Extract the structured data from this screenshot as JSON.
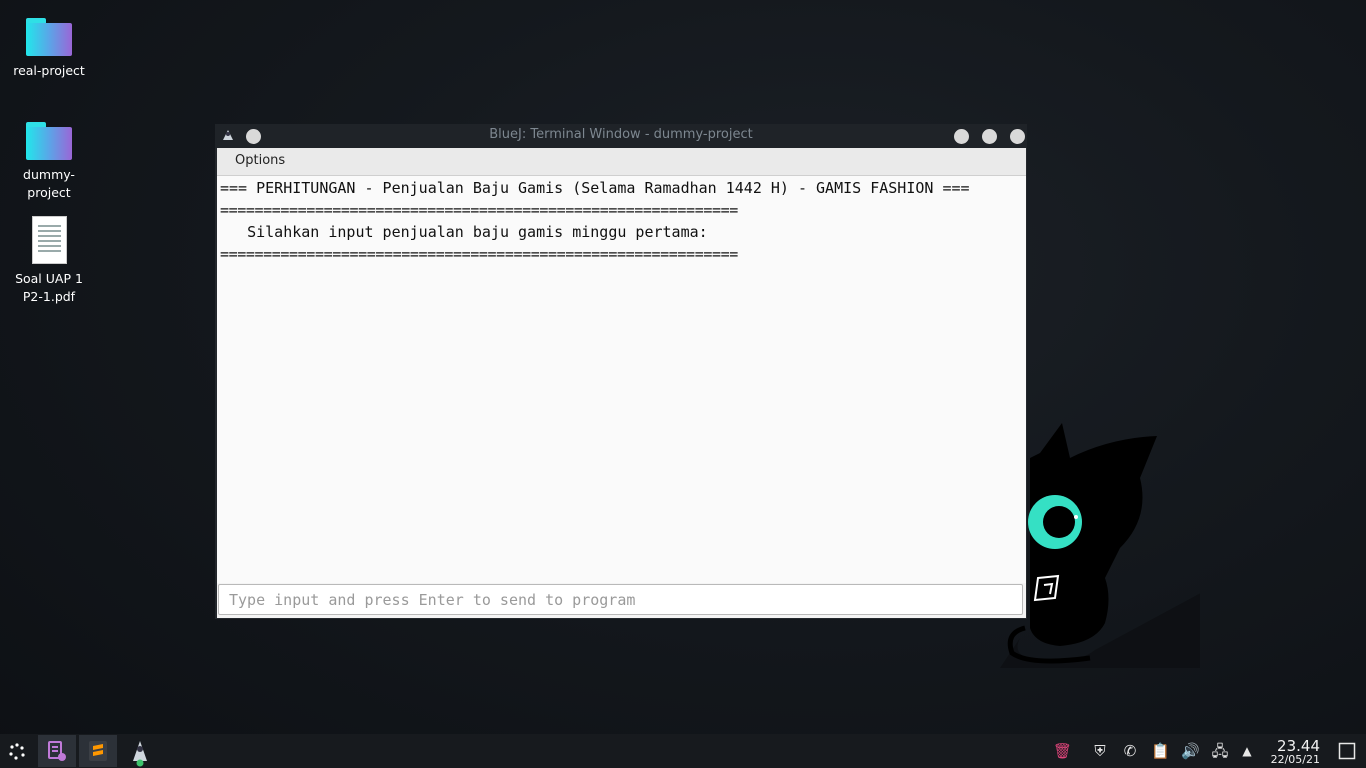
{
  "desktop": {
    "icons": [
      {
        "label": "real-project"
      },
      {
        "label": "dummy-\nproject"
      },
      {
        "label": "Soal UAP 1\nP2-1.pdf"
      }
    ]
  },
  "window": {
    "title": "BlueJ: Terminal Window - dummy-project",
    "menu": {
      "options": "Options"
    },
    "lines": [
      "=== PERHITUNGAN - Penjualan Baju Gamis (Selama Ramadhan 1442 H) - GAMIS FASHION ===",
      "============================================================",
      "   Silahkan input penjualan baju gamis minggu pertama:",
      "============================================================"
    ],
    "input": {
      "value": "",
      "placeholder": "Type input and press Enter to send to program"
    }
  },
  "taskbar": {
    "clock": {
      "time": "23.44",
      "date": "22/05/21"
    }
  },
  "colors": {
    "folder_start": "#21e7ea",
    "folder_end": "#9a66d6",
    "accent": "#35e0c4"
  }
}
